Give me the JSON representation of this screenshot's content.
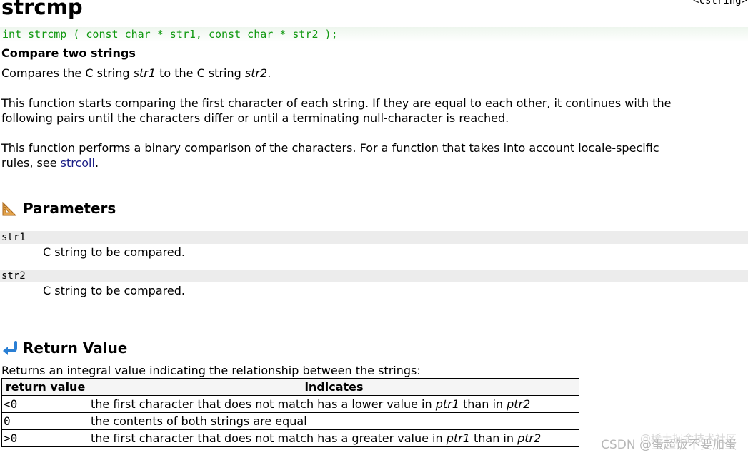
{
  "header": {
    "title": "strcmp",
    "library": "<cstring>"
  },
  "prototype": "int strcmp ( const char * str1, const char * str2 );",
  "subtitle": "Compare two strings",
  "description": {
    "p1": {
      "a": "Compares the C string ",
      "b": "str1",
      "c": " to the C string ",
      "d": "str2",
      "e": "."
    },
    "p2": {
      "line1": "This function starts comparing the first character of each string. If they are equal to each other, it continues with the",
      "line2": "following pairs until the characters differ or until a terminating null-character is reached."
    },
    "p3": {
      "line1": "This function performs a binary comparison of the characters. For a function that takes into account locale-specific",
      "line2a": "rules, see ",
      "link": "strcoll",
      "line2b": "."
    }
  },
  "parameters": {
    "heading": "Parameters",
    "items": [
      {
        "name": "str1",
        "desc": "C string to be compared."
      },
      {
        "name": "str2",
        "desc": "C string to be compared."
      }
    ]
  },
  "return_value": {
    "heading": "Return Value",
    "intro": "Returns an integral value indicating the relationship between the strings:",
    "columns": [
      "return value",
      "indicates"
    ],
    "rows": [
      {
        "value": "<0",
        "a": "the first character that does not match has a lower value in ",
        "p1": "ptr1",
        "b": " than in ",
        "p2": "ptr2"
      },
      {
        "value": "0",
        "a": "the contents of both strings are equal",
        "p1": "",
        "b": "",
        "p2": ""
      },
      {
        "value": ">0",
        "a": "the first character that does not match has a greater value in ",
        "p1": "ptr1",
        "b": " than in ",
        "p2": "ptr2"
      }
    ]
  },
  "watermark": {
    "line1": "@稀土掘金技术社区",
    "line2": "CSDN @蛋超饭不要加蛋"
  },
  "icons": {
    "parameters": "ruler-triangle-icon",
    "return_value": "return-arrow-icon"
  },
  "colors": {
    "prototype_text": "#119911",
    "rule": "#33457d",
    "link": "#1a1d85",
    "param_bar": "#ececec"
  }
}
